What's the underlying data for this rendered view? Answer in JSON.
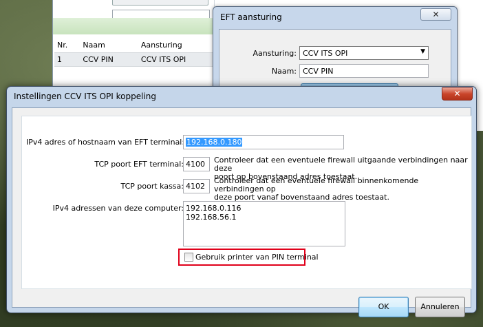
{
  "background_window": {
    "table": {
      "columns": [
        "Nr.",
        "Naam",
        "Aansturing"
      ],
      "rows": [
        {
          "nr": "1",
          "naam": "CCV PIN",
          "aansturing": "CCV ITS OPI"
        }
      ]
    }
  },
  "eft_window": {
    "title": "EFT aansturing",
    "close_label": "✕",
    "aansturing_label": "Aansturing:",
    "aansturing_value": "CCV ITS OPI",
    "naam_label": "Naam:",
    "naam_value": "CCV PIN"
  },
  "dialog": {
    "title": "Instellingen CCV ITS OPI koppeling",
    "close_label": "✕",
    "host_label": "IPv4 adres of hostnaam van EFT terminal:",
    "host_value": "192.168.0.180",
    "tcp_eft_label": "TCP poort EFT terminal:",
    "tcp_eft_value": "4100",
    "tcp_eft_note_1": "Controleer dat een eventuele firewall uitgaande verbindingen naar deze",
    "tcp_eft_note_2": "poort op bovenstaand adres toestaat.",
    "tcp_kassa_label": "TCP poort kassa:",
    "tcp_kassa_value": "4102",
    "tcp_kassa_note_1": "Controleer dat een eventuele firewall binnenkomende verbindingen op",
    "tcp_kassa_note_2": "deze poort vanaf bovenstaand adres toestaat.",
    "ipv4_list_label": "IPv4 adressen van deze computer:",
    "ipv4_list": [
      "192.168.0.116",
      "192.168.56.1"
    ],
    "checkbox_label": "Gebruik printer van PIN terminal",
    "checkbox_checked": false,
    "ok_label": "OK",
    "cancel_label": "Annuleren"
  },
  "colors": {
    "highlight_box": "#e0001a",
    "selection": "#3399ff",
    "window_frame": "#c5d6ea"
  }
}
